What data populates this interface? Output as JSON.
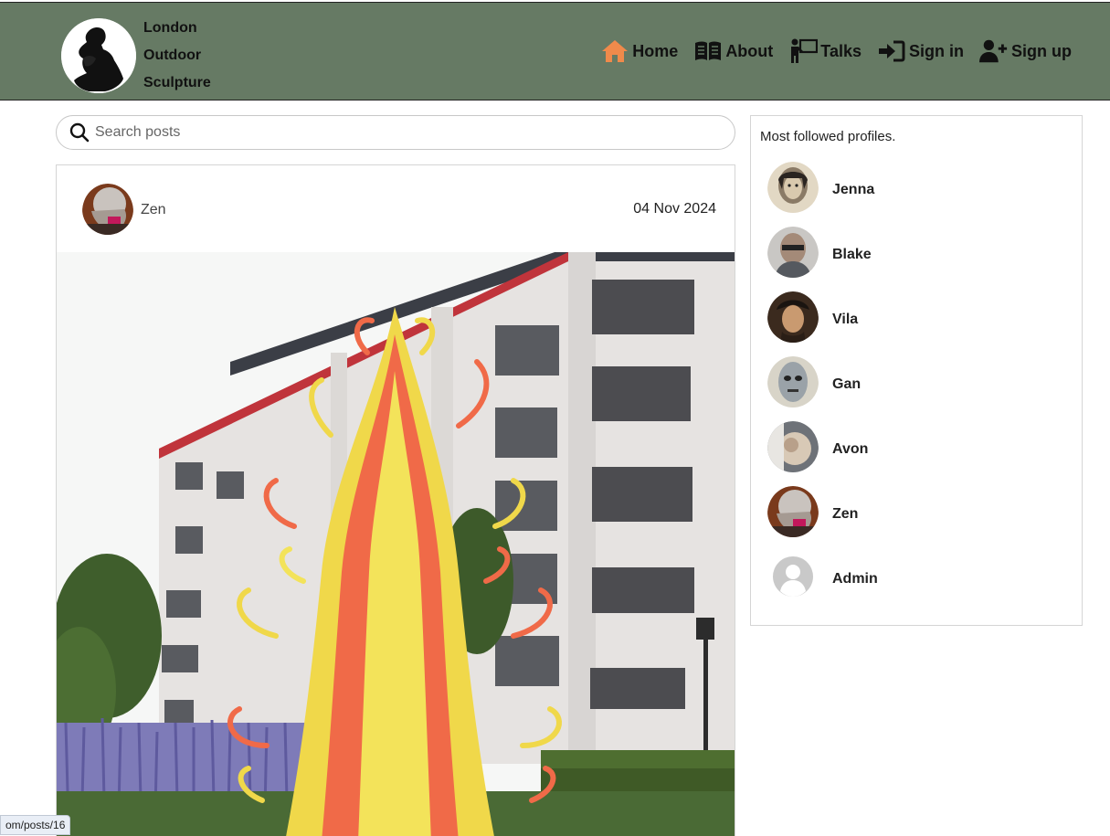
{
  "brand": {
    "lines": [
      "London",
      "Outdoor",
      "Sculpture"
    ],
    "logo_icon": "thinker-silhouette-icon"
  },
  "nav": {
    "items": [
      {
        "label": "Home",
        "icon": "home-icon",
        "color": "#f08a4b"
      },
      {
        "label": "About",
        "icon": "book-icon",
        "color": "#111111"
      },
      {
        "label": "Talks",
        "icon": "presenter-icon",
        "color": "#111111"
      },
      {
        "label": "Sign in",
        "icon": "sign-in-icon",
        "color": "#111111"
      },
      {
        "label": "Sign up",
        "icon": "user-plus-icon",
        "color": "#111111"
      }
    ]
  },
  "search": {
    "placeholder": "Search posts",
    "value": ""
  },
  "post": {
    "author": "Zen",
    "date": "04 Nov 2024"
  },
  "sidebar": {
    "title": "Most followed profiles.",
    "profiles": [
      {
        "name": "Jenna"
      },
      {
        "name": "Blake"
      },
      {
        "name": "Vila"
      },
      {
        "name": "Gan"
      },
      {
        "name": "Avon"
      },
      {
        "name": "Zen"
      },
      {
        "name": "Admin"
      }
    ]
  },
  "status_bar": {
    "url": "om/posts/16"
  },
  "colors": {
    "navbar": "#667a64",
    "active_nav_icon": "#f08a4b"
  }
}
